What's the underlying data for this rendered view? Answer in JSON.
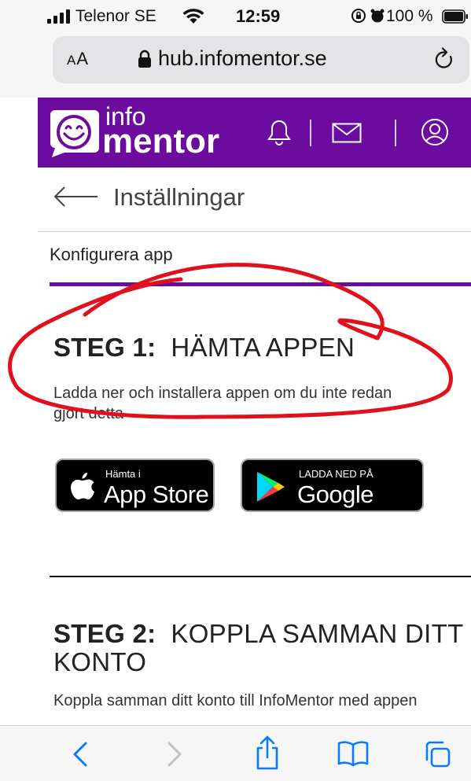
{
  "status_bar": {
    "carrier": "Telenor SE",
    "time": "12:59",
    "battery": "100 %"
  },
  "browser": {
    "text_size_label_small": "A",
    "text_size_label_big": "A",
    "url": "hub.infomentor.se"
  },
  "header": {
    "logo_line1": "info",
    "logo_line2": "mentor",
    "brand_color": "#6c0c9f"
  },
  "page": {
    "back_title": "Inställningar",
    "section_label": "Konfigurera app"
  },
  "step1": {
    "number": "STEG 1:",
    "title": "HÄMTA APPEN",
    "description_line1": "Ladda ner och installera appen om du inte redan",
    "description_line2": "gjort detta"
  },
  "badges": {
    "app_store_small": "Hämta i",
    "app_store_big": "App Store",
    "google_play_small": "LADDA NED PÅ",
    "google_play_big": "Google Play"
  },
  "step2": {
    "number": "STEG 2:",
    "title_line1": "KOPPLA SAMMAN DITT",
    "title_line2": "KONTO",
    "description": "Koppla samman ditt konto till InfoMentor med appen"
  },
  "annotation_color": "#e0101c",
  "toolbar_accent_color": "#0a7aff"
}
